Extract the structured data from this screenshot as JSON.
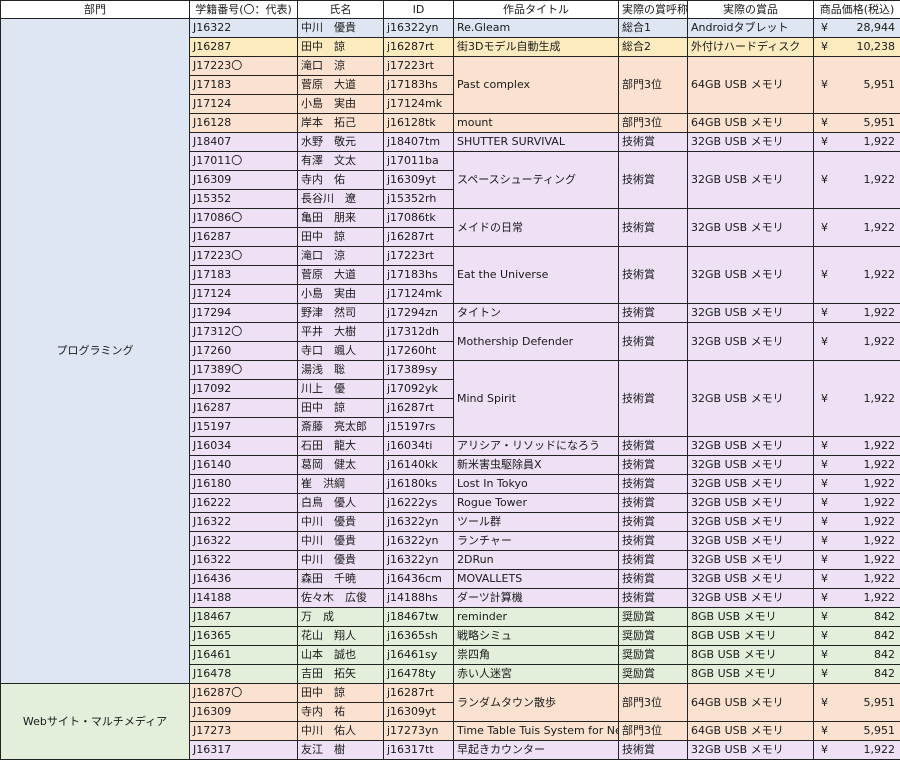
{
  "headers": [
    "部門",
    "学籍番号(〇：代表)",
    "氏名",
    "ID",
    "作品タイトル",
    "実際の賞呼称",
    "実際の賞品",
    "商品価格(税込)"
  ],
  "currency_symbol": "¥",
  "departments": [
    {
      "name": "プログラミング",
      "rows": 35
    },
    {
      "name": "Webサイト・マルチメディア",
      "rows": 4
    }
  ],
  "colors": {
    "blue": "#dde6f2",
    "yellow": "#fcebbf",
    "orange": "#fbe2d0",
    "purple": "#eee1f6",
    "green": "#e3efdb"
  },
  "rows": [
    {
      "student_id": "J16322",
      "name": "中川　優貴",
      "id": "j16322yn"
    },
    {
      "student_id": "J16287",
      "name": "田中　諒",
      "id": "j16287rt"
    },
    {
      "student_id": "J17223〇",
      "name": "滝口　涼",
      "id": "j17223rt"
    },
    {
      "student_id": "J17183",
      "name": "菅原　大道",
      "id": "j17183hs"
    },
    {
      "student_id": "J17124",
      "name": "小島　実由",
      "id": "j17124mk"
    },
    {
      "student_id": "J16128",
      "name": "岸本　拓己",
      "id": "j16128tk"
    },
    {
      "student_id": "J18407",
      "name": "水野　敬元",
      "id": "j18407tm"
    },
    {
      "student_id": "J17011〇",
      "name": "有澤　文太",
      "id": "j17011ba"
    },
    {
      "student_id": "J16309",
      "name": "寺内　佑",
      "id": "j16309yt"
    },
    {
      "student_id": "J15352",
      "name": "長谷川　遼",
      "id": "j15352rh"
    },
    {
      "student_id": "J17086〇",
      "name": "亀田　朋来",
      "id": "j17086tk"
    },
    {
      "student_id": "J16287",
      "name": "田中　諒",
      "id": "j16287rt"
    },
    {
      "student_id": "J17223〇",
      "name": "滝口　涼",
      "id": "j17223rt"
    },
    {
      "student_id": "J17183",
      "name": "菅原　大道",
      "id": "j17183hs"
    },
    {
      "student_id": "J17124",
      "name": "小島　実由",
      "id": "j17124mk"
    },
    {
      "student_id": "J17294",
      "name": "野津　然司",
      "id": "j17294zn"
    },
    {
      "student_id": "J17312〇",
      "name": "平井　大樹",
      "id": "j17312dh"
    },
    {
      "student_id": "J17260",
      "name": "寺口　颯人",
      "id": "j17260ht"
    },
    {
      "student_id": "J17389〇",
      "name": "湯浅　聡",
      "id": "j17389sy"
    },
    {
      "student_id": "J17092",
      "name": "川上　優",
      "id": "j17092yk"
    },
    {
      "student_id": "J16287",
      "name": "田中　諒",
      "id": "j16287rt"
    },
    {
      "student_id": "J15197",
      "name": "斎藤　亮太郎",
      "id": "j15197rs"
    },
    {
      "student_id": "J16034",
      "name": "石田　龍大",
      "id": "j16034ti"
    },
    {
      "student_id": "J16140",
      "name": "葛岡　健太",
      "id": "j16140kk"
    },
    {
      "student_id": "J16180",
      "name": "崔　洪綱",
      "id": "j16180ks"
    },
    {
      "student_id": "J16222",
      "name": "白鳥　優人",
      "id": "j16222ys"
    },
    {
      "student_id": "J16322",
      "name": "中川　優貴",
      "id": "j16322yn"
    },
    {
      "student_id": "J16322",
      "name": "中川　優貴",
      "id": "j16322yn"
    },
    {
      "student_id": "J16322",
      "name": "中川　優貴",
      "id": "j16322yn"
    },
    {
      "student_id": "J16436",
      "name": "森田　千暁",
      "id": "j16436cm"
    },
    {
      "student_id": "J14188",
      "name": "佐々木　広俊",
      "id": "j14188hs"
    },
    {
      "student_id": "J18467",
      "name": "万　成",
      "id": "j18467tw"
    },
    {
      "student_id": "J16365",
      "name": "花山　翔人",
      "id": "j16365sh"
    },
    {
      "student_id": "J16461",
      "name": "山本　誠也",
      "id": "j16461sy"
    },
    {
      "student_id": "J16478",
      "name": "吉田　拓矢",
      "id": "j16478ty"
    },
    {
      "student_id": "J16287〇",
      "name": "田中　諒",
      "id": "j16287rt"
    },
    {
      "student_id": "J16309",
      "name": "寺内　祐",
      "id": "j16309yt"
    },
    {
      "student_id": "J17273",
      "name": "中川　佑人",
      "id": "j17273yn"
    },
    {
      "student_id": "J16317",
      "name": "友江　樹",
      "id": "j16317tt"
    }
  ],
  "works": [
    {
      "title": "Re.Gleam",
      "award": "総合1",
      "prize": "Androidタブレット",
      "price": "28,944",
      "rows": 1,
      "color": "blue"
    },
    {
      "title": "街3Dモデル自動生成",
      "award": "総合2",
      "prize": "外付けハードディスク",
      "price": "10,238",
      "rows": 1,
      "color": "yellow"
    },
    {
      "title": "Past complex",
      "award": "部門3位",
      "prize": "64GB USB メモリ",
      "price": "5,951",
      "rows": 3,
      "color": "orange"
    },
    {
      "title": "mount",
      "award": "部門3位",
      "prize": "64GB USB メモリ",
      "price": "5,951",
      "rows": 1,
      "color": "orange"
    },
    {
      "title": "SHUTTER SURVIVAL",
      "award": "技術賞",
      "prize": "32GB USB メモリ",
      "price": "1,922",
      "rows": 1,
      "color": "purple"
    },
    {
      "title": "スペースシューティング",
      "award": "技術賞",
      "prize": "32GB USB メモリ",
      "price": "1,922",
      "rows": 3,
      "color": "purple"
    },
    {
      "title": "メイドの日常",
      "award": "技術賞",
      "prize": "32GB USB メモリ",
      "price": "1,922",
      "rows": 2,
      "color": "purple"
    },
    {
      "title": "Eat the Universe",
      "award": "技術賞",
      "prize": "32GB USB メモリ",
      "price": "1,922",
      "rows": 3,
      "color": "purple"
    },
    {
      "title": "タイトン",
      "award": "技術賞",
      "prize": "32GB USB メモリ",
      "price": "1,922",
      "rows": 1,
      "color": "purple"
    },
    {
      "title": "Mothership Defender",
      "award": "技術賞",
      "prize": "32GB USB メモリ",
      "price": "1,922",
      "rows": 2,
      "color": "purple"
    },
    {
      "title": "Mind Spirit",
      "award": "技術賞",
      "prize": "32GB USB メモリ",
      "price": "1,922",
      "rows": 4,
      "color": "purple"
    },
    {
      "title": "アリシア・リソッドになろう",
      "award": "技術賞",
      "prize": "32GB USB メモリ",
      "price": "1,922",
      "rows": 1,
      "color": "purple"
    },
    {
      "title": "新米害虫駆除員X",
      "award": "技術賞",
      "prize": "32GB USB メモリ",
      "price": "1,922",
      "rows": 1,
      "color": "purple"
    },
    {
      "title": "Lost In Tokyo",
      "award": "技術賞",
      "prize": "32GB USB メモリ",
      "price": "1,922",
      "rows": 1,
      "color": "purple"
    },
    {
      "title": "Rogue Tower",
      "award": "技術賞",
      "prize": "32GB USB メモリ",
      "price": "1,922",
      "rows": 1,
      "color": "purple"
    },
    {
      "title": "ツール群",
      "award": "技術賞",
      "prize": "32GB USB メモリ",
      "price": "1,922",
      "rows": 1,
      "color": "purple"
    },
    {
      "title": "ランチャー",
      "award": "技術賞",
      "prize": "32GB USB メモリ",
      "price": "1,922",
      "rows": 1,
      "color": "purple"
    },
    {
      "title": "2DRun",
      "award": "技術賞",
      "prize": "32GB USB メモリ",
      "price": "1,922",
      "rows": 1,
      "color": "purple"
    },
    {
      "title": "MOVALLETS",
      "award": "技術賞",
      "prize": "32GB USB メモリ",
      "price": "1,922",
      "rows": 1,
      "color": "purple"
    },
    {
      "title": "ダーツ計算機",
      "award": "技術賞",
      "prize": "32GB USB メモリ",
      "price": "1,922",
      "rows": 1,
      "color": "purple"
    },
    {
      "title": "reminder",
      "award": "奨励賞",
      "prize": "8GB USB メモリ",
      "price": "842",
      "rows": 1,
      "color": "green"
    },
    {
      "title": "戦略シミュ",
      "award": "奨励賞",
      "prize": "8GB USB メモリ",
      "price": "842",
      "rows": 1,
      "color": "green"
    },
    {
      "title": "祟四角",
      "award": "奨励賞",
      "prize": "8GB USB メモリ",
      "price": "842",
      "rows": 1,
      "color": "green"
    },
    {
      "title": "赤い人迷宮",
      "award": "奨励賞",
      "prize": "8GB USB メモリ",
      "price": "842",
      "rows": 1,
      "color": "green"
    },
    {
      "title": "ランダムタウン散歩",
      "award": "部門3位",
      "prize": "64GB USB メモリ",
      "price": "5,951",
      "rows": 2,
      "color": "orange"
    },
    {
      "title": "Time Table Tuis System for Net",
      "award": "部門3位",
      "prize": "64GB USB メモリ",
      "price": "5,951",
      "rows": 1,
      "color": "orange"
    },
    {
      "title": "早起きカウンター",
      "award": "技術賞",
      "prize": "32GB USB メモリ",
      "price": "1,922",
      "rows": 1,
      "color": "purple"
    }
  ]
}
